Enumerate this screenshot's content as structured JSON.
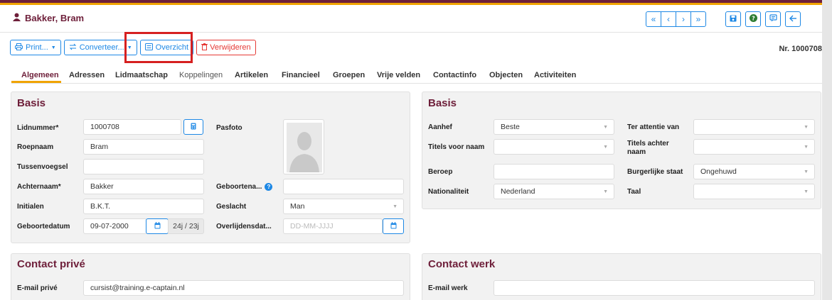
{
  "header": {
    "title": "Bakker, Bram",
    "user_icon": "user-icon",
    "nav": {
      "first": "«",
      "prev": "‹",
      "next": "›",
      "last": "»"
    },
    "actions": {
      "save": "save-icon",
      "help": "help-icon",
      "comment": "comment-icon",
      "back": "back-arrow-icon"
    }
  },
  "toolbar": {
    "print": "Print...",
    "convert": "Converteer...",
    "overview": "Overzicht",
    "delete": "Verwijderen"
  },
  "record_nr": "Nr. 1000708",
  "tabs": [
    "Algemeen",
    "Adressen",
    "Lidmaatschap",
    "Koppelingen",
    "Artikelen",
    "Financieel",
    "Groepen",
    "Vrije velden",
    "Contactinfo",
    "Objecten",
    "Activiteiten"
  ],
  "basis_left": {
    "title": "Basis",
    "lidnummer": {
      "label": "Lidnummer*",
      "value": "1000708"
    },
    "roepnaam": {
      "label": "Roepnaam",
      "value": "Bram"
    },
    "tussenvoegsel": {
      "label": "Tussenvoegsel",
      "value": ""
    },
    "achternaam": {
      "label": "Achternaam*",
      "value": "Bakker"
    },
    "initialen": {
      "label": "Initialen",
      "value": "B.K.T."
    },
    "geboortedatum": {
      "label": "Geboortedatum",
      "value": "09-07-2000",
      "age": "24j / 23j"
    },
    "pasfoto": {
      "label": "Pasfoto"
    },
    "geboorteplaats": {
      "label": "Geboortena...",
      "value": ""
    },
    "geslacht": {
      "label": "Geslacht",
      "value": "Man"
    },
    "overlijdensdatum": {
      "label": "Overlijdensdat...",
      "placeholder": "DD-MM-JJJJ"
    }
  },
  "basis_right": {
    "title": "Basis",
    "aanhef": {
      "label": "Aanhef",
      "value": "Beste"
    },
    "titels_voor": {
      "label": "Titels voor naam",
      "value": ""
    },
    "beroep": {
      "label": "Beroep",
      "value": ""
    },
    "nationaliteit": {
      "label": "Nationaliteit",
      "value": "Nederland"
    },
    "ter_attentie": {
      "label": "Ter attentie van",
      "value": ""
    },
    "titels_achter": {
      "label": "Titels achter naam",
      "value": ""
    },
    "burgerlijke_staat": {
      "label": "Burgerlijke staat",
      "value": "Ongehuwd"
    },
    "taal": {
      "label": "Taal",
      "value": ""
    }
  },
  "contact_prive": {
    "title": "Contact privé",
    "email_label": "E-mail privé",
    "email_value": "cursist@training.e-captain.nl"
  },
  "contact_werk": {
    "title": "Contact werk",
    "email_label": "E-mail werk",
    "email_value": ""
  }
}
